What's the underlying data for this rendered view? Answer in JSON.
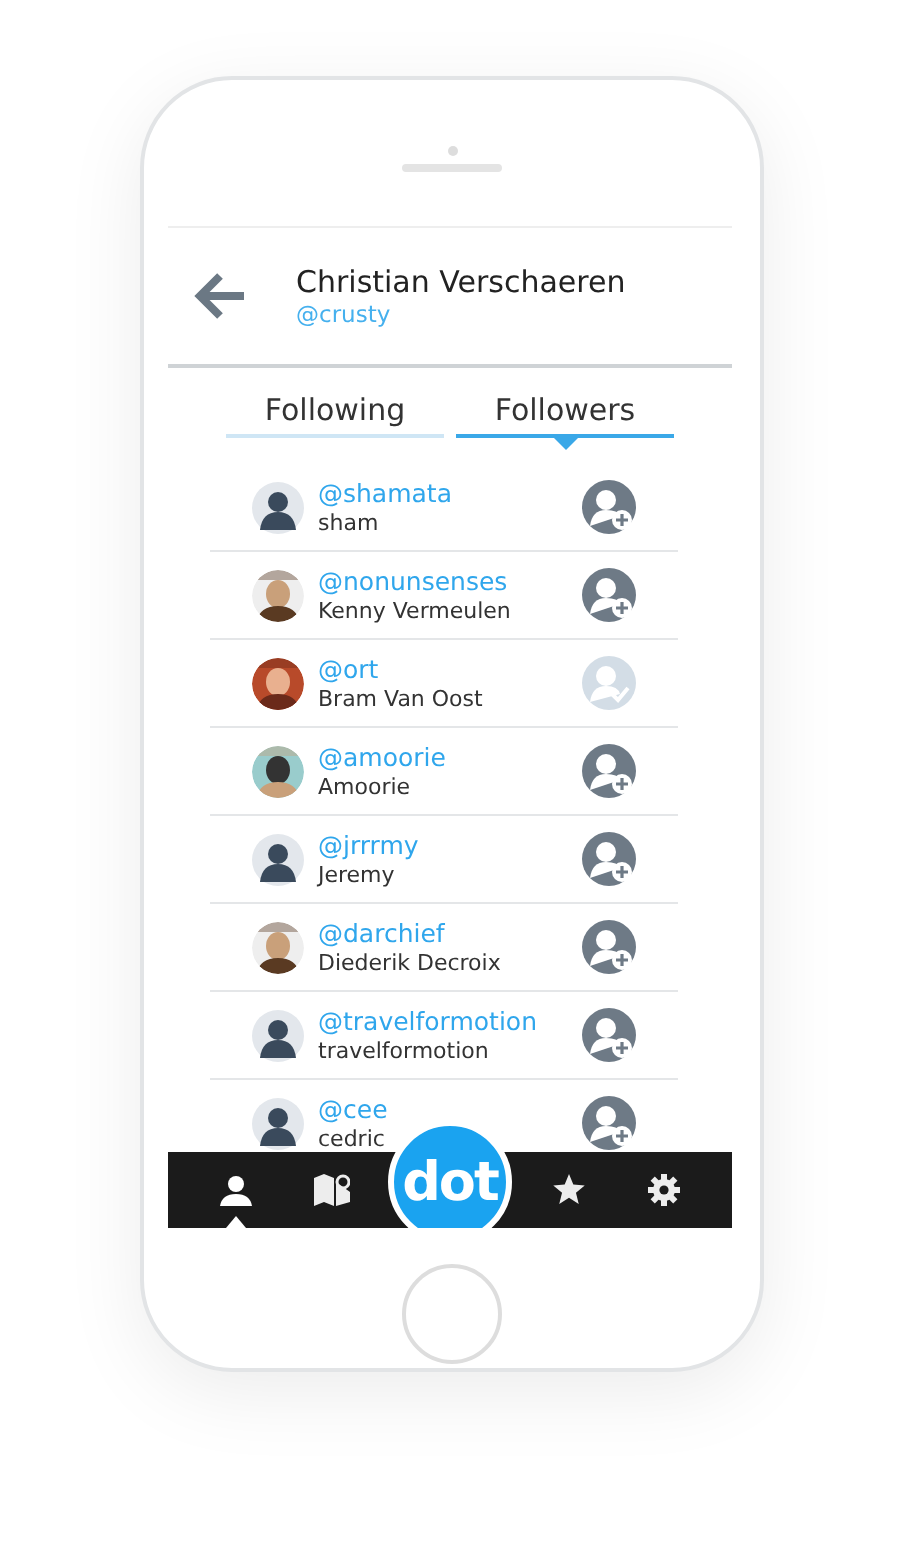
{
  "header": {
    "name": "Christian Verschaeren",
    "handle": "@crusty"
  },
  "tabs": [
    {
      "label": "Following",
      "selected": false
    },
    {
      "label": "Followers",
      "selected": true
    }
  ],
  "users": [
    {
      "handle": "@shamata",
      "name": "sham",
      "kind": "default",
      "followed": false
    },
    {
      "handle": "@nonunsenses",
      "name": "Kenny Vermeulen",
      "followed": false
    },
    {
      "handle": "@ort",
      "name": "Bram Van Oost",
      "followed": true
    },
    {
      "handle": "@amoorie",
      "name": "Amoorie",
      "followed": false
    },
    {
      "handle": "@jrrrmy",
      "name": "Jeremy",
      "kind": "default",
      "followed": false
    },
    {
      "handle": "@darchief",
      "name": "Diederik Decroix",
      "followed": false
    },
    {
      "handle": "@travelformotion",
      "name": "travelformotion",
      "kind": "default",
      "followed": false
    },
    {
      "handle": "@cee",
      "name": "cedric",
      "kind": "default",
      "followed": false
    }
  ],
  "nav": [
    {
      "kind": "person",
      "selected": true
    },
    {
      "kind": "map",
      "selected": false
    },
    {
      "kind": "logo",
      "label": "dot"
    },
    {
      "kind": "star",
      "selected": false
    },
    {
      "kind": "gear",
      "selected": false
    }
  ]
}
